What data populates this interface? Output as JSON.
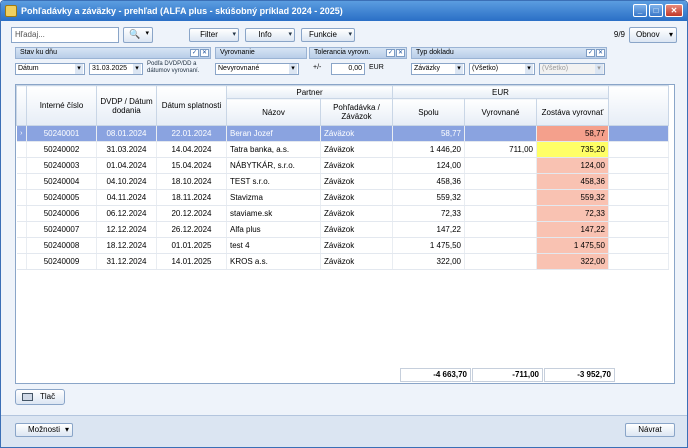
{
  "window": {
    "title": "Pohľadávky a záväzky - prehľad (ALFA plus - skúšobný príklad 2024 - 2025)"
  },
  "toolbar": {
    "search_placeholder": "Hľadaj...",
    "filter_label": "Filter",
    "info_label": "Info",
    "funkcie_label": "Funkcie",
    "page_info": "9/9",
    "refresh_label": "Obnov"
  },
  "filters": {
    "stav_header": "Stav ku dňu",
    "stav_field": "Dátum",
    "stav_date": "31.03.2025",
    "stav_note": "Podľa DVDP/DD a dátumov vyrovnaní.",
    "vyrovnanie_header": "Vyrovnanie",
    "vyrovnanie_value": "Nevyrovnané",
    "tolerancia_header": "Tolerancia vyrovn.",
    "tolerancia_sign": "+/-",
    "tolerancia_value": "0,00",
    "tolerancia_currency": "EUR",
    "typ_header": "Typ dokladu",
    "typ_value": "Záväzky",
    "typ_value2": "(Všetko)",
    "typ_value3": "(Všetko)"
  },
  "grid": {
    "group_partner": "Partner",
    "group_eur": "EUR",
    "columns": [
      "Interné číslo",
      "DVDP / Dátum dodania",
      "Dátum splatnosti",
      "Názov",
      "Pohľadávka / Záväzok",
      "Spolu",
      "Vyrovnané",
      "Zostáva vyrovnať"
    ],
    "rows": [
      [
        "50240001",
        "08.01.2024",
        "22.01.2024",
        "Beran Jozef",
        "Záväzok",
        "58,77",
        "",
        "58,77"
      ],
      [
        "50240002",
        "31.03.2024",
        "14.04.2024",
        "Tatra banka, a.s.",
        "Záväzok",
        "1 446,20",
        "711,00",
        "735,20"
      ],
      [
        "50240003",
        "01.04.2024",
        "15.04.2024",
        "NÁBYTKÁR, s.r.o.",
        "Záväzok",
        "124,00",
        "",
        "124,00"
      ],
      [
        "50240004",
        "04.10.2024",
        "18.10.2024",
        "TEST s.r.o.",
        "Záväzok",
        "458,36",
        "",
        "458,36"
      ],
      [
        "50240005",
        "04.11.2024",
        "18.11.2024",
        "Stavizma",
        "Záväzok",
        "559,32",
        "",
        "559,32"
      ],
      [
        "50240006",
        "06.12.2024",
        "20.12.2024",
        "staviame.sk",
        "Záväzok",
        "72,33",
        "",
        "72,33"
      ],
      [
        "50240007",
        "12.12.2024",
        "26.12.2024",
        "Alfa plus",
        "Záväzok",
        "147,22",
        "",
        "147,22"
      ],
      [
        "50240008",
        "18.12.2024",
        "01.01.2025",
        "test 4",
        "Záväzok",
        "1 475,50",
        "",
        "1 475,50"
      ],
      [
        "50240009",
        "31.12.2024",
        "14.01.2025",
        "KROS a.s.",
        "Záväzok",
        "322,00",
        "",
        "322,00"
      ]
    ],
    "totals": {
      "spolu": "-4 663,70",
      "vyrovnane": "-711,00",
      "zostava": "-3 952,70"
    }
  },
  "footer": {
    "print_label": "Tlač",
    "moznosti_label": "Možnosti",
    "navrat_label": "Návrat"
  }
}
